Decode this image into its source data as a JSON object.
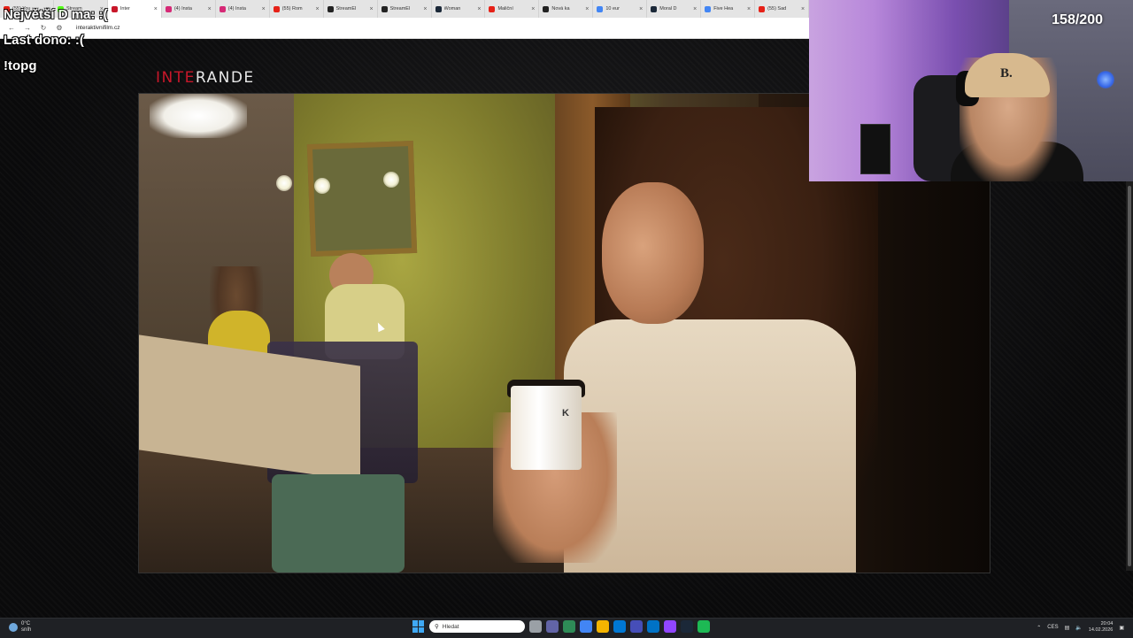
{
  "browser": {
    "tabs": [
      {
        "label": "(55) You",
        "color": "#e62117"
      },
      {
        "label": "Stream",
        "color": "#53fc18"
      },
      {
        "label": "Inter",
        "color": "#c8172a",
        "active": true
      },
      {
        "label": "(4) Insta",
        "color": "#d62976"
      },
      {
        "label": "(4) Insta",
        "color": "#d62976"
      },
      {
        "label": "(55) Rom",
        "color": "#e62117"
      },
      {
        "label": "StreamEl",
        "color": "#222222"
      },
      {
        "label": "StreamEl",
        "color": "#222222"
      },
      {
        "label": "Woman",
        "color": "#1b2838"
      },
      {
        "label": "Maliční",
        "color": "#e62117"
      },
      {
        "label": "Nová ka",
        "color": "#222222"
      },
      {
        "label": "10 eur",
        "color": "#4285f4"
      },
      {
        "label": "Moral D",
        "color": "#1b2838"
      },
      {
        "label": "Five Hea",
        "color": "#4285f4"
      },
      {
        "label": "(55) Sad",
        "color": "#e62117"
      }
    ],
    "url": "interaktivnifilm.cz"
  },
  "overlay": {
    "line1": "Největší D ma: :(",
    "line2": "Last dono: :(",
    "line3": "!topg"
  },
  "logo": {
    "part1": "INTE",
    "part2": "RANDE"
  },
  "video": {
    "cup_text": "K"
  },
  "webcam": {
    "counter": "158/200",
    "cap_letter": "B."
  },
  "taskbar": {
    "weather_temp": "0°C",
    "weather_desc": "sníh",
    "search_placeholder": "Hledat",
    "language": "CES",
    "time": "20:04",
    "date": "14.02.2026",
    "app_colors": [
      "#9aa0a6",
      "#6264a7",
      "#2e8b57",
      "#4285f4",
      "#f4b400",
      "#0078d4",
      "#464eb8",
      "#0072c6",
      "#9146ff",
      "#1b2838",
      "#1db954"
    ]
  }
}
